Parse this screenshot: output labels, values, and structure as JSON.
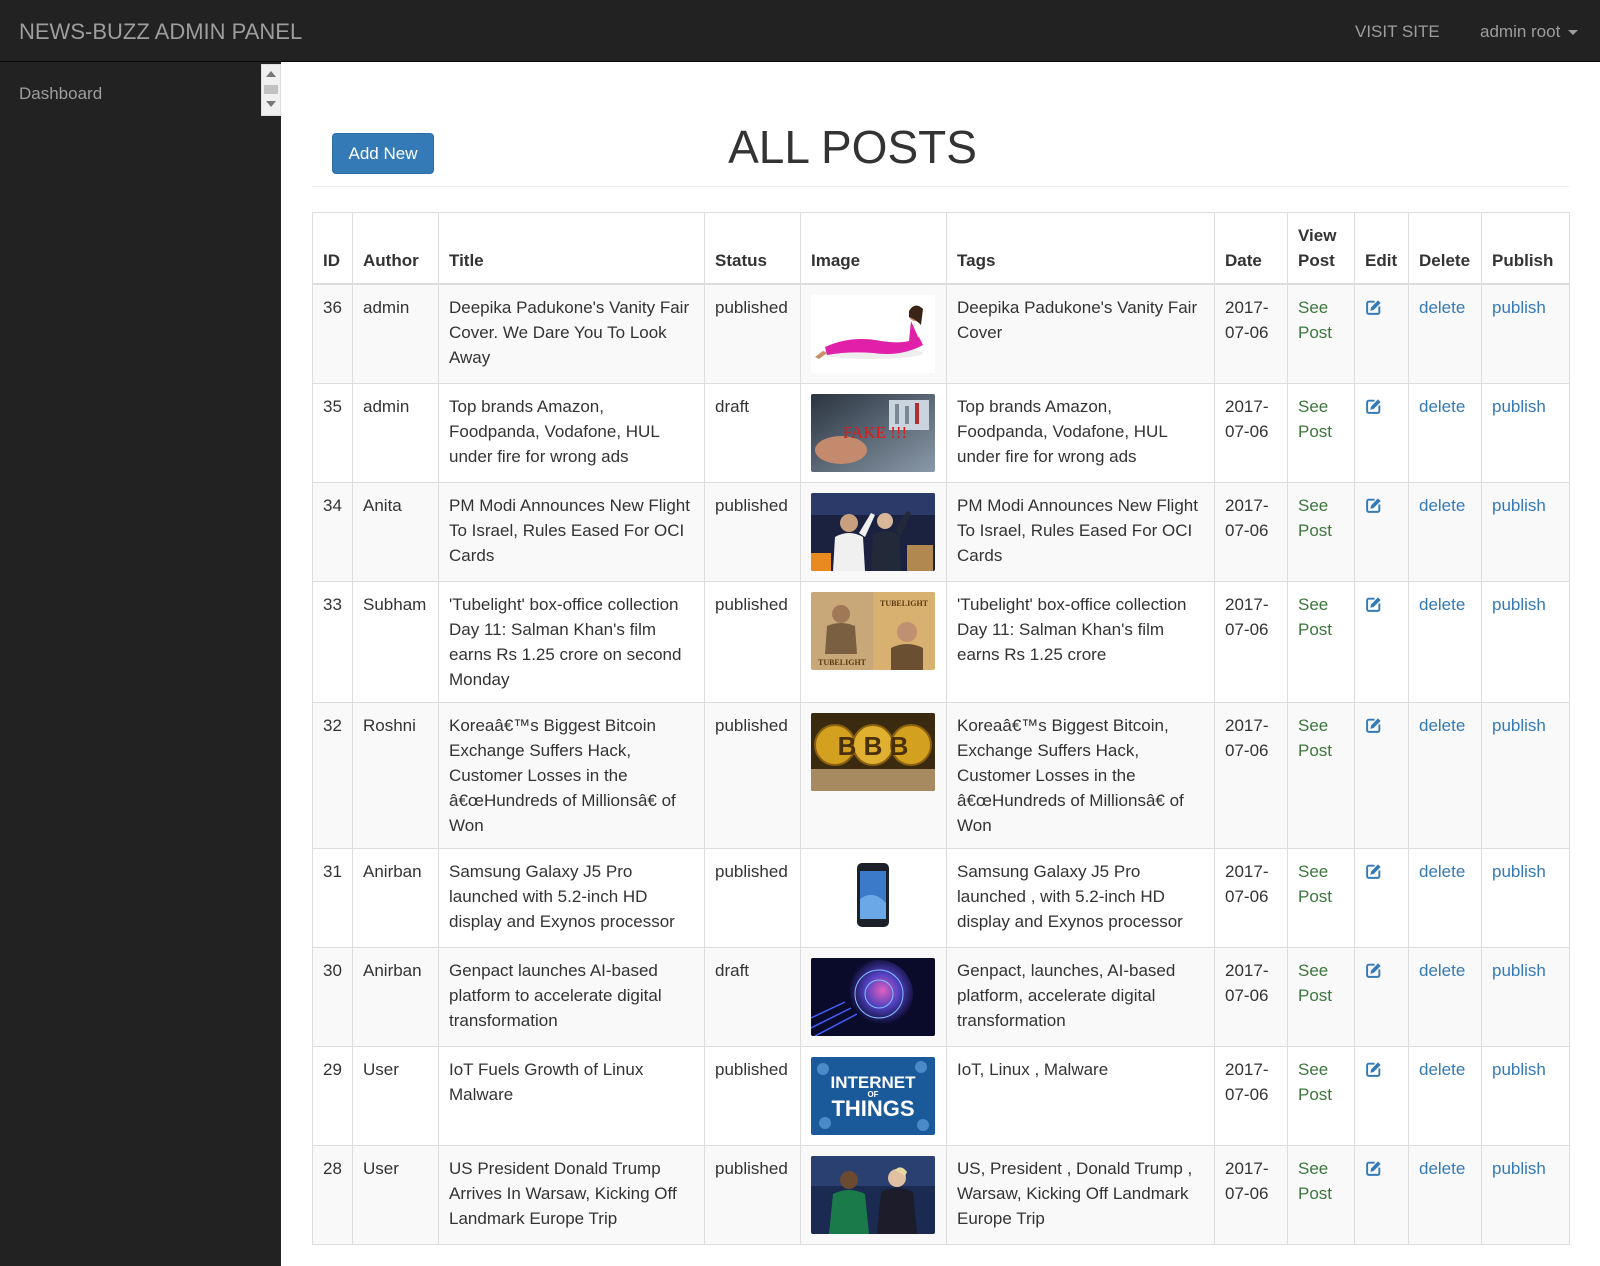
{
  "navbar": {
    "brand": "NEWS-BUZZ ADMIN PANEL",
    "visit_site": "VISIT SITE",
    "user": "admin root"
  },
  "sidebar": {
    "items": [
      {
        "label": "Dashboard"
      }
    ]
  },
  "main": {
    "add_new_label": "Add New",
    "title": "ALL POSTS"
  },
  "table": {
    "headers": {
      "id": "ID",
      "author": "Author",
      "title": "Title",
      "status": "Status",
      "image": "Image",
      "tags": "Tags",
      "date": "Date",
      "view_post": "View Post",
      "edit": "Edit",
      "delete": "Delete",
      "publish": "Publish"
    },
    "see_post_label": "See Post",
    "delete_label": "delete",
    "publish_label": "publish",
    "rows": [
      {
        "id": "36",
        "author": "admin",
        "title": "Deepika Padukone's Vanity Fair Cover. We Dare You To Look Away",
        "status": "published",
        "tags": "Deepika Padukone's Vanity Fair Cover",
        "date": "2017-07-06"
      },
      {
        "id": "35",
        "author": "admin",
        "title": "Top brands Amazon, Foodpanda, Vodafone, HUL under fire for wrong ads",
        "status": "draft",
        "tags": "Top brands Amazon, Foodpanda, Vodafone, HUL under fire for wrong ads",
        "date": "2017-07-06"
      },
      {
        "id": "34",
        "author": "Anita",
        "title": "PM Modi Announces New Flight To Israel, Rules Eased For OCI Cards",
        "status": "published",
        "tags": "PM Modi Announces New Flight To Israel, Rules Eased For OCI Cards",
        "date": "2017-07-06"
      },
      {
        "id": "33",
        "author": "Subham",
        "title": "'Tubelight' box-office collection Day 11: Salman Khan's film earns Rs 1.25 crore on second Monday",
        "status": "published",
        "tags": "'Tubelight' box-office collection Day 11: Salman Khan's film earns Rs 1.25 crore",
        "date": "2017-07-06"
      },
      {
        "id": "32",
        "author": "Roshni",
        "title": "Koreaâ€™s Biggest Bitcoin Exchange Suffers Hack, Customer Losses in the â€œHundreds of Millionsâ€ of Won",
        "status": "published",
        "tags": "Koreaâ€™s Biggest Bitcoin, Exchange Suffers Hack, Customer Losses in the â€œHundreds of Millionsâ€ of Won",
        "date": "2017-07-06"
      },
      {
        "id": "31",
        "author": "Anirban",
        "title": "Samsung Galaxy J5 Pro launched with 5.2-inch HD display and Exynos processor",
        "status": "published",
        "tags": "Samsung Galaxy J5 Pro launched , with 5.2-inch HD display and Exynos processor",
        "date": "2017-07-06"
      },
      {
        "id": "30",
        "author": "Anirban",
        "title": "Genpact launches AI-based platform to accelerate digital transformation",
        "status": "draft",
        "tags": "Genpact, launches, AI-based platform, accelerate digital transformation",
        "date": "2017-07-06"
      },
      {
        "id": "29",
        "author": "User",
        "title": "IoT Fuels Growth of Linux Malware",
        "status": "published",
        "tags": "IoT, Linux , Malware",
        "date": "2017-07-06"
      },
      {
        "id": "28",
        "author": "User",
        "title": "US President Donald Trump Arrives In Warsaw, Kicking Off Landmark Europe Trip",
        "status": "published",
        "tags": "US, President , Donald Trump , Warsaw, Kicking Off Landmark Europe Trip",
        "date": "2017-07-06"
      }
    ],
    "image_texts": {
      "row_35": "FAKE !!!",
      "row_33_a": "TUBELIGHT",
      "row_33_b": "TUBELIGHT",
      "row_32": "B B B",
      "row_29_a": "INTERNET",
      "row_29_b": "OF",
      "row_29_c": "THINGS"
    }
  }
}
